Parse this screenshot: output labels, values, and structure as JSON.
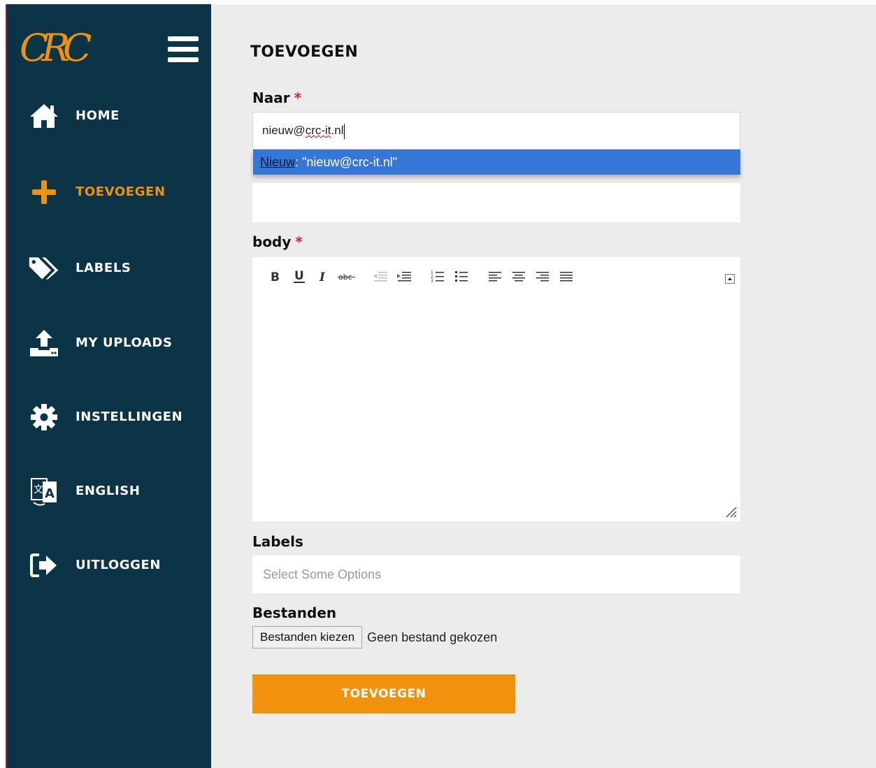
{
  "brand": {
    "logo_text": "CRC"
  },
  "nav": {
    "items": [
      {
        "label": "HOME",
        "icon": "home-icon"
      },
      {
        "label": "TOEVOEGEN",
        "icon": "plus-icon",
        "active": true
      },
      {
        "label": "LABELS",
        "icon": "tags-icon"
      },
      {
        "label": "MY UPLOADS",
        "icon": "upload-icon"
      },
      {
        "label": "INSTELLINGEN",
        "icon": "gear-icon"
      },
      {
        "label": "ENGLISH",
        "icon": "translate-icon"
      },
      {
        "label": "UITLOGGEN",
        "icon": "logout-icon"
      }
    ]
  },
  "form": {
    "title": "TOEVOEGEN",
    "naar": {
      "label": "Naar",
      "required_mark": "*",
      "value_prefix": "nieuw@",
      "value_spell": "crc-it",
      "value_suffix": ".nl"
    },
    "suggestion": {
      "highlight": "Nieuw",
      "text": ": \"nieuw@crc-it.nl\""
    },
    "body": {
      "label": "body",
      "required_mark": "*"
    },
    "labels": {
      "label": "Labels",
      "placeholder": "Select Some Options"
    },
    "files": {
      "label": "Bestanden",
      "button_label": "Bestanden kiezen",
      "status": "Geen bestand gekozen"
    },
    "submit_label": "TOEVOEGEN"
  },
  "editor_toolbar": [
    "bold",
    "underline",
    "italic",
    "strikethrough",
    "outdent",
    "indent",
    "ordered-list",
    "unordered-list",
    "align-left",
    "align-center",
    "align-right",
    "align-justify"
  ],
  "colors": {
    "sidebar_bg": "#0c3447",
    "accent": "#f0920e",
    "main_bg": "#ececec",
    "suggestion_bg": "#3876d6",
    "required": "#e0241b"
  }
}
